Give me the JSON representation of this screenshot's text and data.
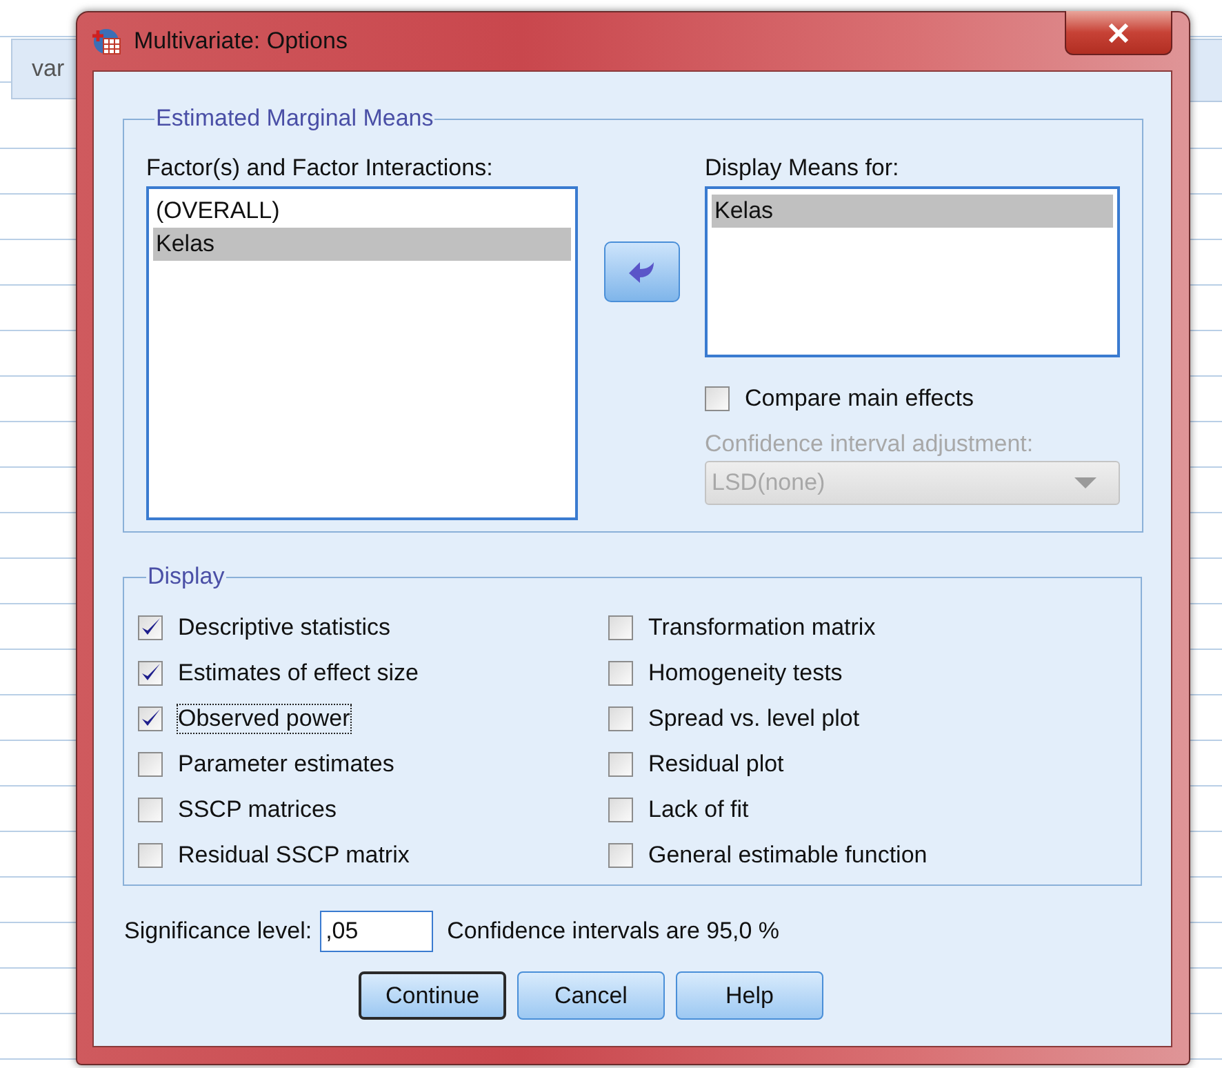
{
  "background": {
    "column_header": "var"
  },
  "window": {
    "title": "Multivariate: Options"
  },
  "estimated_marginal_means": {
    "title": "Estimated Marginal Means",
    "factors": {
      "label": "Factor(s) and Factor Interactions:",
      "items": [
        {
          "text": "(OVERALL)",
          "selected": false
        },
        {
          "text": "Kelas",
          "selected": true
        }
      ]
    },
    "display_means": {
      "label": "Display Means for:",
      "items": [
        {
          "text": "Kelas",
          "selected": true
        }
      ]
    },
    "compare_main_effects": {
      "label": "Compare main effects",
      "checked": false
    },
    "adjustment": {
      "label": "Confidence interval adjustment:",
      "value": "LSD(none)",
      "disabled": true
    }
  },
  "display": {
    "title": "Display",
    "left_column": [
      {
        "label": "Descriptive statistics",
        "checked": true,
        "focused": false
      },
      {
        "label": "Estimates of effect size",
        "checked": true,
        "focused": false
      },
      {
        "label": "Observed power",
        "checked": true,
        "focused": true
      },
      {
        "label": "Parameter estimates",
        "checked": false,
        "focused": false
      },
      {
        "label": "SSCP matrices",
        "checked": false,
        "focused": false
      },
      {
        "label": "Residual SSCP matrix",
        "checked": false,
        "focused": false
      }
    ],
    "right_column": [
      {
        "label": "Transformation matrix",
        "checked": false,
        "focused": false
      },
      {
        "label": "Homogeneity tests",
        "checked": false,
        "focused": false
      },
      {
        "label": "Spread vs. level plot",
        "checked": false,
        "focused": false
      },
      {
        "label": "Residual plot",
        "checked": false,
        "focused": false
      },
      {
        "label": "Lack of fit",
        "checked": false,
        "focused": false
      },
      {
        "label": "General estimable function",
        "checked": false,
        "focused": false
      }
    ]
  },
  "significance": {
    "label": "Significance level:",
    "value": ",05",
    "note": "Confidence intervals are 95,0 %"
  },
  "buttons": [
    {
      "label": "Continue",
      "default": true
    },
    {
      "label": "Cancel",
      "default": false
    },
    {
      "label": "Help",
      "default": false
    }
  ]
}
